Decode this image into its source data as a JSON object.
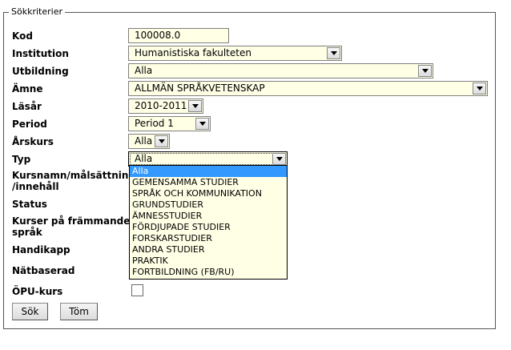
{
  "form": {
    "legend": "Sökkriterier",
    "labels": {
      "kod": "Kod",
      "institution": "Institution",
      "utbildning": "Utbildning",
      "amne": "Ämne",
      "lasar": "Läsår",
      "period": "Period",
      "arskurs": "Årskurs",
      "typ": "Typ",
      "kursnamn_1": "Kursnamn/målsättning",
      "kursnamn_2": "/innehåll",
      "status": "Status",
      "frammande_1": "Kurser på främmande",
      "frammande_2": "språk",
      "handikapp": "Handikapp",
      "natbaserad": "Nätbaserad",
      "opu": "ÖPU-kurs"
    },
    "values": {
      "kod": "100008.0",
      "institution": "Humanistiska fakulteten",
      "utbildning": "Alla",
      "amne": "ALLMÄN SPRÅKVETENSKAP",
      "lasar": "2010-2011",
      "period": "Period 1",
      "arskurs": "Alla",
      "typ": "Alla"
    },
    "typ_options": [
      "Alla",
      "GEMENSAMMA STUDIER",
      "SPRÅK OCH KOMMUNIKATION",
      "GRUNDSTUDIER",
      "ÄMNESSTUDIER",
      "FÖRDJUPADE STUDIER",
      "FORSKARSTUDIER",
      "ANDRA STUDIER",
      "PRAKTIK",
      "FORTBILDNING (FB/RU)"
    ],
    "buttons": {
      "search": "Sök",
      "clear": "Töm"
    }
  }
}
